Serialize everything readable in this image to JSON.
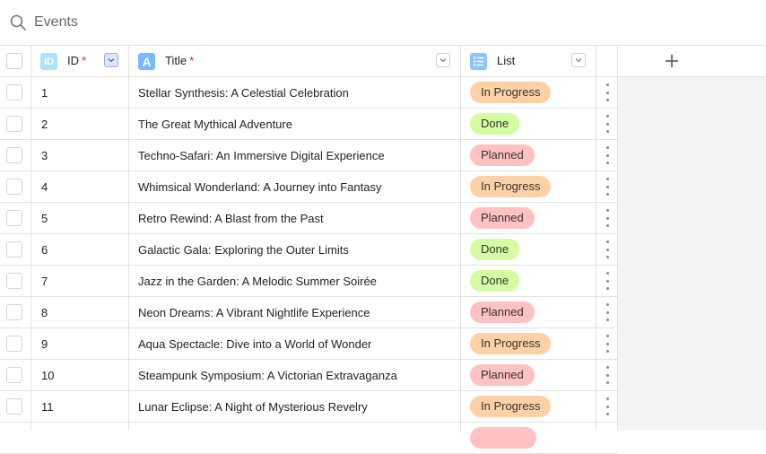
{
  "search": {
    "placeholder": "Events"
  },
  "columns": {
    "id": {
      "type_icon": "ID",
      "label": "ID",
      "required_mark": "*"
    },
    "title": {
      "type_icon": "A",
      "label": "Title",
      "required_mark": "*"
    },
    "list": {
      "label": "List"
    }
  },
  "add_column_icon": "plus-icon",
  "status_colors": {
    "In Progress": "#fdd1a6",
    "Done": "#d4fca0",
    "Planned": "#ffc1c1"
  },
  "rows": [
    {
      "id": "1",
      "title": "Stellar Synthesis: A Celestial Celebration",
      "status": "In Progress"
    },
    {
      "id": "2",
      "title": "The Great Mythical Adventure",
      "status": "Done"
    },
    {
      "id": "3",
      "title": "Techno-Safari: An Immersive Digital Experience",
      "status": "Planned"
    },
    {
      "id": "4",
      "title": "Whimsical Wonderland: A Journey into Fantasy",
      "status": "In Progress"
    },
    {
      "id": "5",
      "title": "Retro Rewind: A Blast from the Past",
      "status": "Planned"
    },
    {
      "id": "6",
      "title": "Galactic Gala: Exploring the Outer Limits",
      "status": "Done"
    },
    {
      "id": "7",
      "title": "Jazz in the Garden: A Melodic Summer Soirée",
      "status": "Done"
    },
    {
      "id": "8",
      "title": "Neon Dreams: A Vibrant Nightlife Experience",
      "status": "Planned"
    },
    {
      "id": "9",
      "title": "Aqua Spectacle: Dive into a World of Wonder",
      "status": "In Progress"
    },
    {
      "id": "10",
      "title": "Steampunk Symposium: A Victorian Extravaganza",
      "status": "Planned"
    },
    {
      "id": "11",
      "title": "Lunar Eclipse: A Night of Mysterious Revelry",
      "status": "In Progress"
    }
  ]
}
